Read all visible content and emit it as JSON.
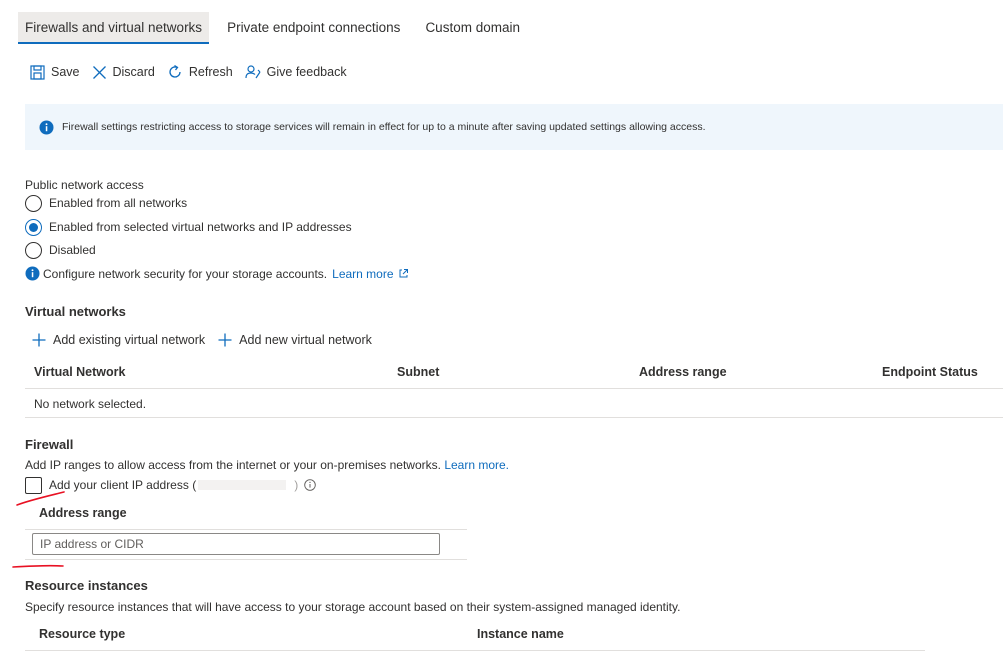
{
  "tabs": [
    {
      "label": "Firewalls and virtual networks",
      "active": true
    },
    {
      "label": "Private endpoint connections",
      "active": false
    },
    {
      "label": "Custom domain",
      "active": false
    }
  ],
  "toolbar": {
    "save_label": "Save",
    "discard_label": "Discard",
    "refresh_label": "Refresh",
    "feedback_label": "Give feedback"
  },
  "info_banner": {
    "text": "Firewall settings restricting access to storage services will remain in effect for up to a minute after saving updated settings allowing access."
  },
  "public_network_access": {
    "label": "Public network access",
    "options": [
      {
        "label": "Enabled from all networks",
        "selected": false
      },
      {
        "label": "Enabled from selected virtual networks and IP addresses",
        "selected": true
      },
      {
        "label": "Disabled",
        "selected": false
      }
    ],
    "hint": "Configure network security for your storage accounts.",
    "learn_more": "Learn more"
  },
  "virtual_networks": {
    "title": "Virtual networks",
    "add_existing_label": "Add existing virtual network",
    "add_new_label": "Add new virtual network",
    "columns": [
      "Virtual Network",
      "Subnet",
      "Address range",
      "Endpoint Status"
    ],
    "empty_text": "No network selected."
  },
  "firewall": {
    "title": "Firewall",
    "description": "Add IP ranges to allow access from the internet or your on-premises networks.",
    "learn_more": "Learn more.",
    "client_ip_label": "Add your client IP address (",
    "client_ip_suffix": ")",
    "client_ip_checked": false,
    "address_range_header": "Address range",
    "address_range_placeholder": "IP address or CIDR",
    "address_range_value": ""
  },
  "resource_instances": {
    "title": "Resource instances",
    "description": "Specify resource instances that will have access to your storage account based on their system-assigned managed identity.",
    "columns": [
      "Resource type",
      "Instance name"
    ]
  },
  "colors": {
    "accent": "#0f6cbd",
    "info_background": "#eff6fc",
    "annotation_red": "#e81123"
  }
}
